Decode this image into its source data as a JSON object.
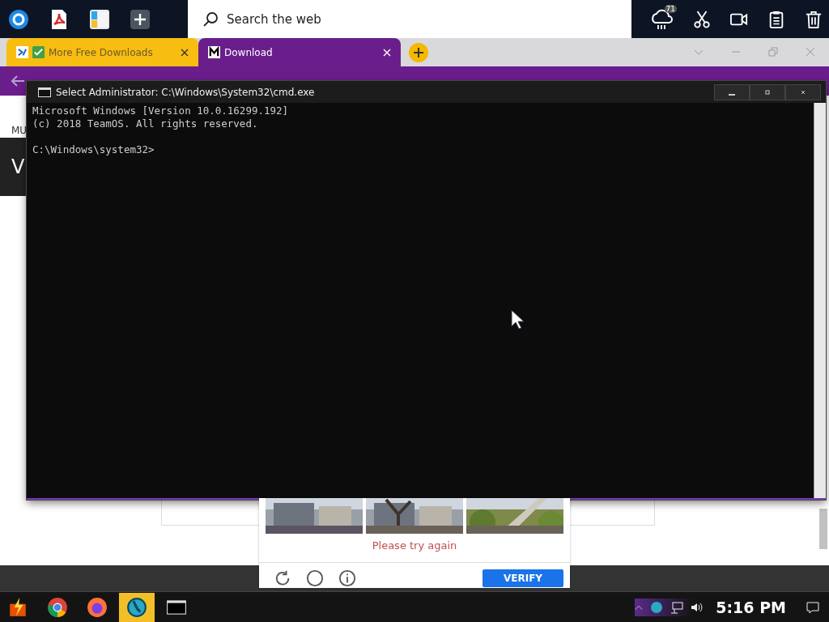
{
  "top_bar": {
    "apps": [
      {
        "kind": "circle"
      },
      {
        "kind": "pdf"
      },
      {
        "kind": "tiles"
      },
      {
        "kind": "plus"
      }
    ],
    "search": {
      "placeholder": "Search the web"
    },
    "weather_badge": "71",
    "tools": [
      {
        "kind": "scissors"
      },
      {
        "kind": "video"
      },
      {
        "kind": "clipboard"
      },
      {
        "kind": "trash"
      }
    ]
  },
  "browser": {
    "tabs": [
      {
        "label": "More Free Downloads",
        "selected": false
      },
      {
        "label": "Download",
        "selected": true
      }
    ]
  },
  "page": {
    "side_texts": [
      "MU",
      "V"
    ],
    "captcha": {
      "error": "Please try again",
      "button": "VERIFY"
    }
  },
  "console": {
    "title": "Select Administrator: C:\\Windows\\System32\\cmd.exe",
    "header": [
      "Microsoft Windows [Version 10.0.16299.192]",
      "(c) 2018 TeamOS. All rights reserved."
    ],
    "prompt": "C:\\Windows\\system32>"
  },
  "taskbar": {
    "apps": [
      {
        "kind": "launcher",
        "selected": false
      },
      {
        "kind": "chrome",
        "selected": false
      },
      {
        "kind": "firefox",
        "selected": false
      },
      {
        "kind": "globe",
        "selected": true
      },
      {
        "kind": "console",
        "selected": false
      }
    ],
    "clock": "5:16 PM"
  }
}
